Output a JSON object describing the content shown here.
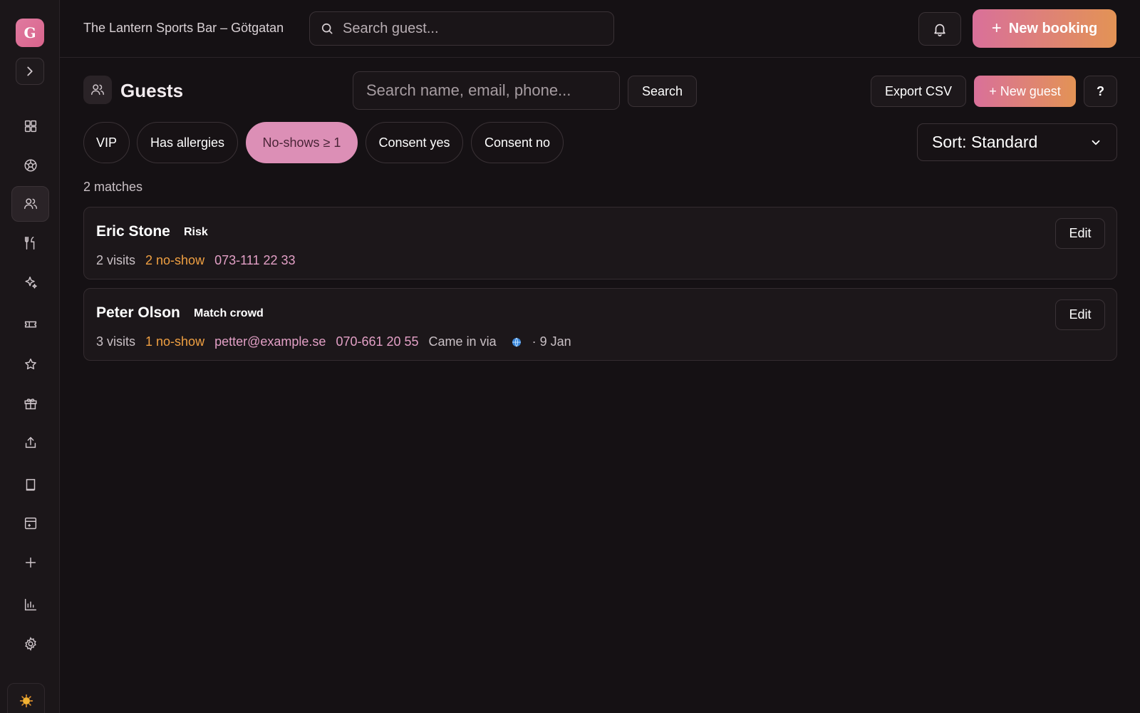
{
  "sidebar": {
    "logo_letter": "G",
    "items": [
      {
        "name": "dashboard-icon"
      },
      {
        "name": "football-icon"
      },
      {
        "name": "users-icon",
        "active": true
      },
      {
        "name": "utensils-icon"
      },
      {
        "name": "sparkles-icon"
      },
      {
        "name": "ticket-icon"
      },
      {
        "name": "star-icon"
      },
      {
        "name": "gift-icon"
      },
      {
        "name": "share-icon"
      },
      {
        "name": "book-icon"
      },
      {
        "name": "layout-icon"
      },
      {
        "name": "plus-icon"
      },
      {
        "name": "bar-chart-icon"
      },
      {
        "name": "gear-icon"
      }
    ]
  },
  "topbar": {
    "venue": "The Lantern Sports Bar – Götgatan",
    "search_placeholder": "Search guest...",
    "new_booking_label": "New booking",
    "new_booking_plus": "+"
  },
  "page": {
    "title": "Guests",
    "search_placeholder": "Search name, email, phone...",
    "search_button": "Search",
    "export_button": "Export CSV",
    "new_guest_button": "+ New guest",
    "help_button": "?"
  },
  "filters": [
    {
      "label": "VIP",
      "active": false
    },
    {
      "label": "Has allergies",
      "active": false
    },
    {
      "label": "No-shows ≥ 1",
      "active": true
    },
    {
      "label": "Consent yes",
      "active": false
    },
    {
      "label": "Consent no",
      "active": false
    }
  ],
  "sort": {
    "selected": "Sort: Standard"
  },
  "matches_text": "2 matches",
  "guests": [
    {
      "name": "Eric Stone",
      "tag": "Risk",
      "visits": "2 visits",
      "no_show": "2 no-show",
      "phone": "073-111 22 33",
      "edit_label": "Edit"
    },
    {
      "name": "Peter Olson",
      "tag": "Match crowd",
      "visits": "3 visits",
      "no_show": "1 no-show",
      "email": "petter@example.se",
      "phone": "070-661 20 55",
      "came_via": "Came in via",
      "date": "· 9 Jan",
      "edit_label": "Edit"
    }
  ],
  "colors": {
    "accent_pink": "#d9709a",
    "accent_orange": "#e39355",
    "no_show": "#f0a042",
    "contact": "#e3a0c6"
  }
}
